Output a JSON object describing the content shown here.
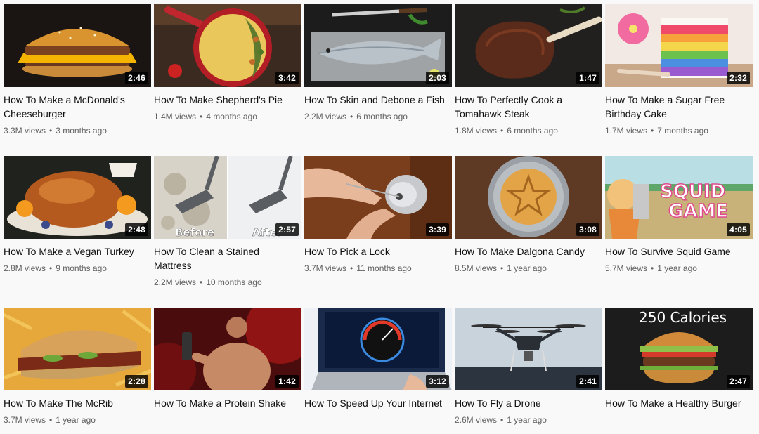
{
  "videos": [
    {
      "title": "How To Make a McDonald's Cheeseburger",
      "duration": "2:46",
      "views": "3.3M views",
      "age": "3 months ago",
      "thumb_icon": "cheeseburger-thumbnail"
    },
    {
      "title": "How To Make Shepherd's Pie",
      "duration": "3:42",
      "views": "1.4M views",
      "age": "4 months ago",
      "thumb_icon": "shepherds-pie-thumbnail"
    },
    {
      "title": "How To Skin and Debone a Fish",
      "duration": "2:03",
      "views": "2.2M views",
      "age": "6 months ago",
      "thumb_icon": "fish-thumbnail"
    },
    {
      "title": "How To Perfectly Cook a Tomahawk Steak",
      "duration": "1:47",
      "views": "1.8M views",
      "age": "6 months ago",
      "thumb_icon": "steak-thumbnail"
    },
    {
      "title": "How To Make a Sugar Free Birthday Cake",
      "duration": "2:32",
      "views": "1.7M views",
      "age": "7 months ago",
      "thumb_icon": "rainbow-cake-thumbnail"
    },
    {
      "title": "How To Make a Vegan Turkey",
      "duration": "2:48",
      "views": "2.8M views",
      "age": "9 months ago",
      "thumb_icon": "turkey-thumbnail"
    },
    {
      "title": "How To Clean a Stained Mattress",
      "duration": "2:57",
      "views": "2.2M views",
      "age": "10 months ago",
      "thumb_icon": "mattress-thumbnail",
      "overlay_before": "Before",
      "overlay_after": "After"
    },
    {
      "title": "How To Pick a Lock",
      "duration": "3:39",
      "views": "3.7M views",
      "age": "11 months ago",
      "thumb_icon": "lock-thumbnail"
    },
    {
      "title": "How To Make Dalgona Candy",
      "duration": "3:08",
      "views": "8.5M views",
      "age": "1 year ago",
      "thumb_icon": "dalgona-thumbnail"
    },
    {
      "title": "How To Survive Squid Game",
      "duration": "4:05",
      "views": "5.7M views",
      "age": "1 year ago",
      "thumb_icon": "squid-game-thumbnail",
      "overlay_line1": "SQUID",
      "overlay_line2": "GAME"
    },
    {
      "title": "How To Make The McRib",
      "duration": "2:28",
      "views": "3.7M views",
      "age": "1 year ago",
      "thumb_icon": "mcrib-thumbnail"
    },
    {
      "title": "How To Make a Protein Shake",
      "duration": "1:42",
      "views": "",
      "age": "",
      "thumb_icon": "protein-shake-thumbnail"
    },
    {
      "title": "How To Speed Up Your Internet",
      "duration": "3:12",
      "views": "",
      "age": "",
      "thumb_icon": "internet-speed-thumbnail"
    },
    {
      "title": "How To Fly a Drone",
      "duration": "2:41",
      "views": "2.6M views",
      "age": "1 year ago",
      "thumb_icon": "drone-thumbnail"
    },
    {
      "title": "How To Make a Healthy Burger",
      "duration": "2:47",
      "views": "",
      "age": "",
      "thumb_icon": "healthy-burger-thumbnail",
      "overlay_text": "250 Calories"
    }
  ],
  "colors": {
    "background": "#f9f9f9",
    "title": "#0f0f0f",
    "meta": "#606060"
  }
}
